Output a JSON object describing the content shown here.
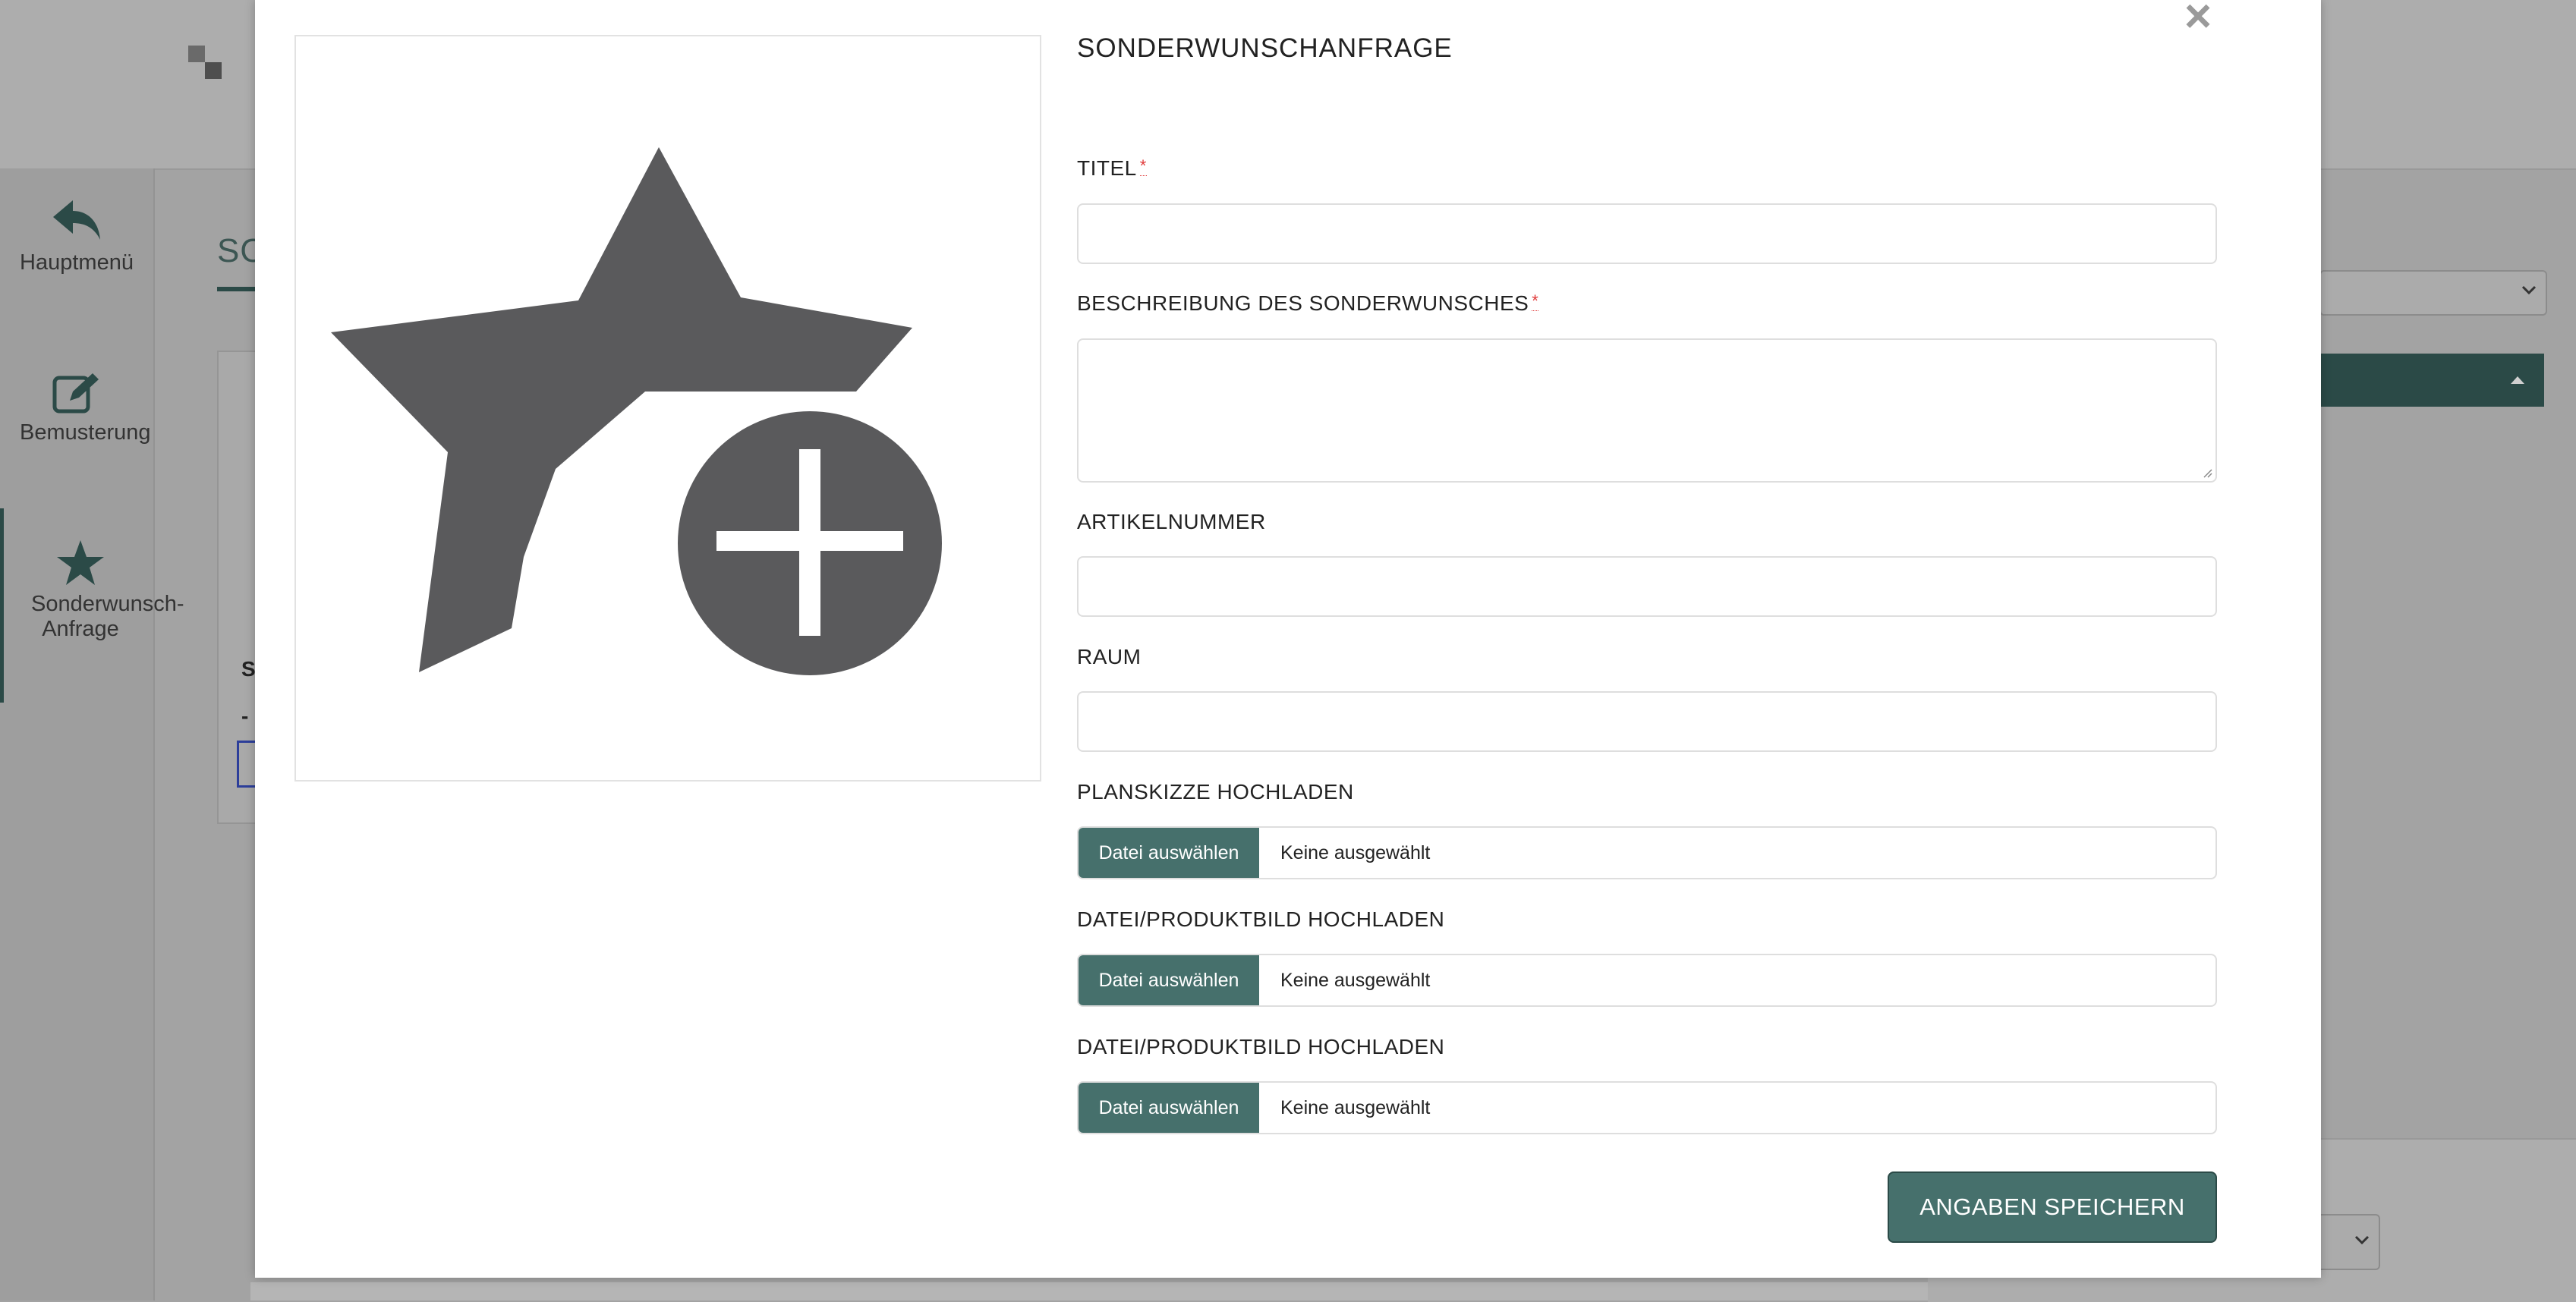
{
  "sidebar": {
    "items": [
      {
        "label": "Hauptmenü",
        "icon": "reply-arrow-icon"
      },
      {
        "label": "Bemusterung",
        "icon": "edit-icon"
      },
      {
        "label": "Sonderwunsch-Anfrage",
        "icon": "star-icon",
        "active": true
      }
    ]
  },
  "background": {
    "page_title_fragment": "SO",
    "card_text_fragment": "S",
    "card_dash": "-"
  },
  "modal": {
    "title": "SONDERWUNSCHANFRAGE",
    "close_glyph": "×",
    "image_icon": "star-plus-icon",
    "fields": {
      "titel": {
        "label": "TITEL",
        "required_mark": "*",
        "value": ""
      },
      "beschreibung": {
        "label": "BESCHREIBUNG DES SONDERWUNSCHES",
        "required_mark": "*",
        "value": ""
      },
      "artikelnummer": {
        "label": "ARTIKELNUMMER",
        "value": ""
      },
      "raum": {
        "label": "RAUM",
        "value": ""
      }
    },
    "uploads": [
      {
        "label": "PLANSKIZZE HOCHLADEN",
        "button": "Datei auswählen",
        "status": "Keine ausgewählt"
      },
      {
        "label": "DATEI/PRODUKTBILD HOCHLADEN",
        "button": "Datei auswählen",
        "status": "Keine ausgewählt"
      },
      {
        "label": "DATEI/PRODUKTBILD HOCHLADEN",
        "button": "Datei auswählen",
        "status": "Keine ausgewählt"
      }
    ],
    "save_button": "ANGABEN SPEICHERN"
  },
  "colors": {
    "primary": "#46706c",
    "primary_dark": "#2b4a47",
    "required": "#e03a3a",
    "icon_gray": "#5a5a5c"
  }
}
